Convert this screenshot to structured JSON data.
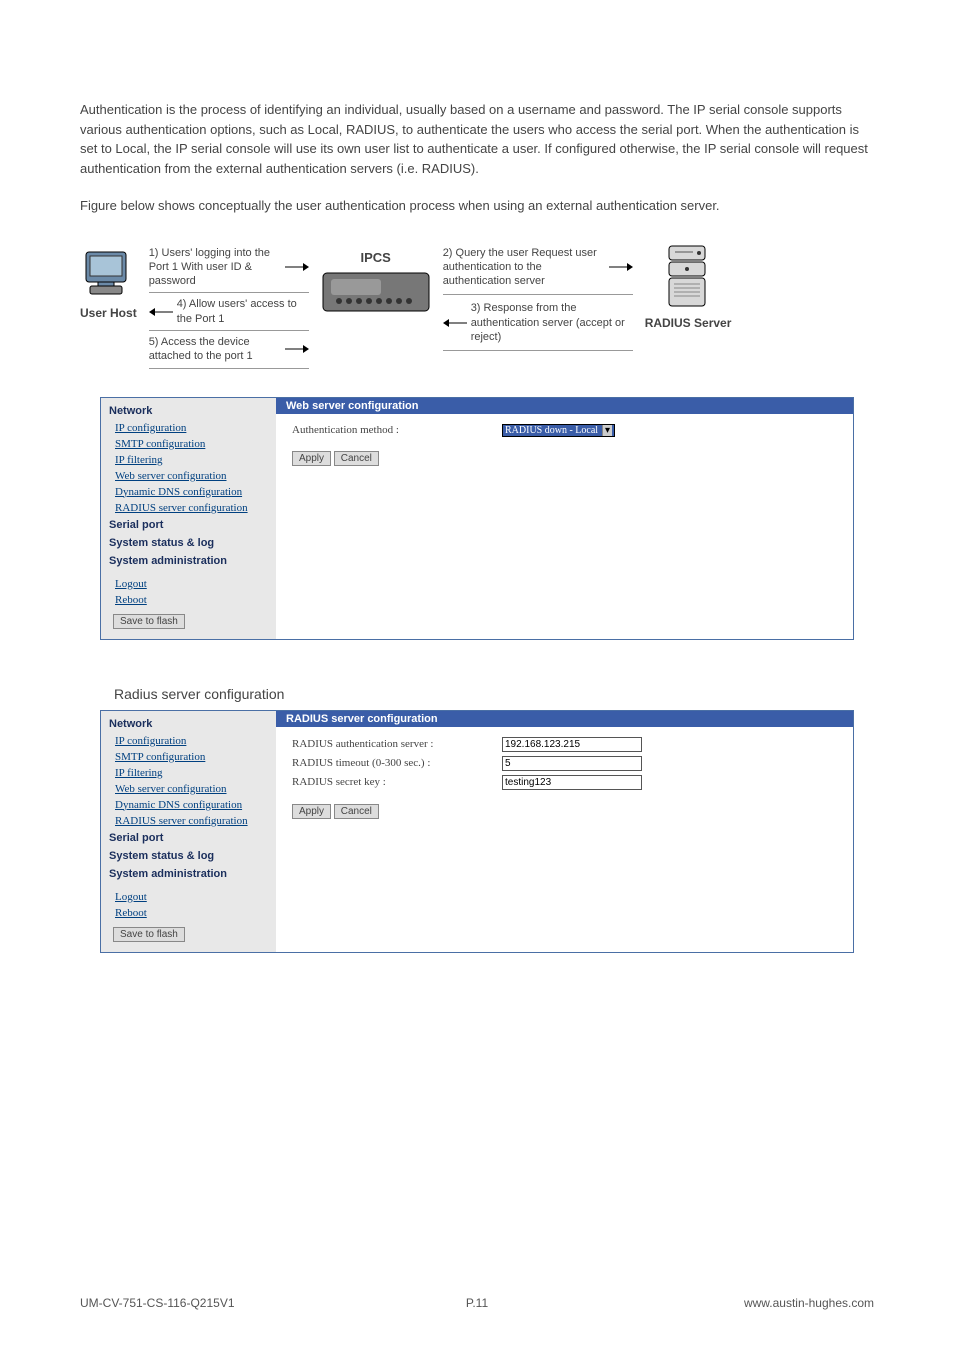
{
  "intro": "Authentication is the process of identifying an individual, usually based on a username and password. The IP serial console supports various authentication options, such as Local, RADIUS, to authenticate the users who access the serial port. When the authentication is set to Local, the IP serial console will use its own user list to authenticate a user. If configured otherwise, the IP serial console will request authentication from the external authentication servers (i.e. RADIUS).",
  "caption": "Figure below shows conceptually the user authentication process when using an external authentication server.",
  "diagram": {
    "user_host": "User Host",
    "ipcs": "IPCS",
    "radius_server": "RADIUS Server",
    "step1": "1) Users' logging into the Port 1 With user ID & password",
    "step4": "4) Allow users' access to the Port 1",
    "step5": "5) Access the device attached to the port 1",
    "step2": "2) Query the user Request user authentication to the authentication server",
    "step3": "3) Response from the authentication server (accept or reject)"
  },
  "sidebar": {
    "cat_network": "Network",
    "ip_config": "IP configuration",
    "smtp_config": "SMTP configuration",
    "ip_filter": "IP filtering",
    "web_server": "Web server configuration",
    "ddns": "Dynamic DNS configuration",
    "radius": "RADIUS server configuration",
    "cat_serial": "Serial port",
    "cat_status": "System status & log",
    "cat_admin": "System administration",
    "logout": "Logout",
    "reboot": "Reboot",
    "save_flash": "Save to flash"
  },
  "panel1": {
    "header": "Web server configuration",
    "auth_label": "Authentication method :",
    "auth_value": "RADIUS down - Local",
    "apply": "Apply",
    "cancel": "Cancel"
  },
  "section2_title": "Radius server configuration",
  "panel2": {
    "header": "RADIUS server configuration",
    "server_label": "RADIUS authentication server :",
    "server_value": "192.168.123.215",
    "timeout_label": "RADIUS timeout (0-300 sec.) :",
    "timeout_value": "5",
    "secret_label": "RADIUS secret key :",
    "secret_value": "testing123",
    "apply": "Apply",
    "cancel": "Cancel"
  },
  "footer": {
    "left": "UM-CV-751-CS-116-Q215V1",
    "center": "P.11",
    "right": "www.austin-hughes.com"
  }
}
